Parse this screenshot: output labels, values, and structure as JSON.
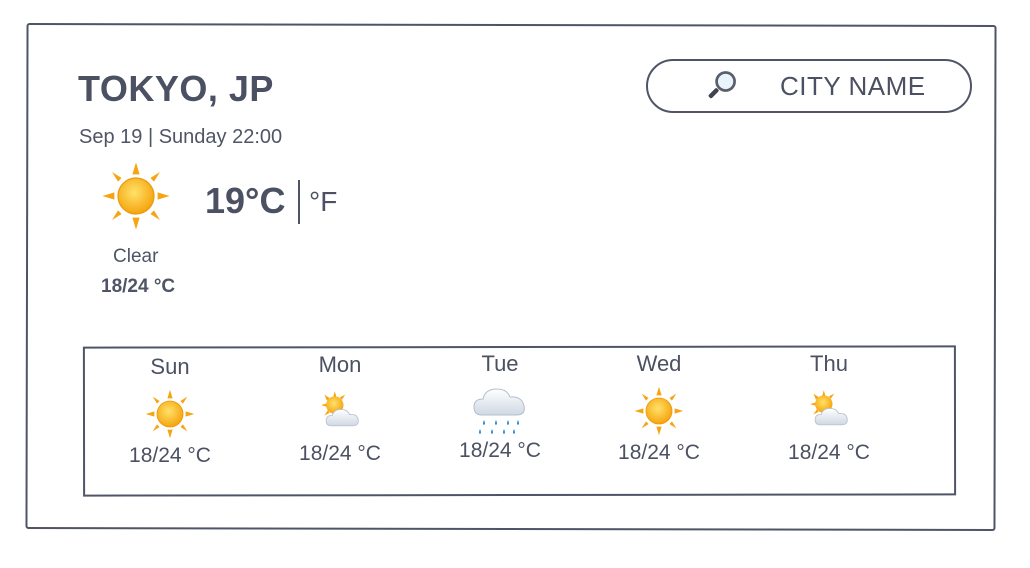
{
  "location": {
    "city": "TOKYO, JP",
    "datetime": "Sep 19 | Sunday 22:00"
  },
  "search": {
    "placeholder": "CITY NAME",
    "icon": "search-icon"
  },
  "current": {
    "icon": "sun-icon",
    "temperature": "19°C",
    "alt_unit": "°F",
    "condition": "Clear",
    "range": "18/24 °C"
  },
  "forecast": [
    {
      "day": "Sun",
      "icon": "sun-icon",
      "range": "18/24 °C"
    },
    {
      "day": "Mon",
      "icon": "sun-behind-cloud-icon",
      "range": "18/24 °C"
    },
    {
      "day": "Tue",
      "icon": "rain-cloud-icon",
      "range": "18/24 °C"
    },
    {
      "day": "Wed",
      "icon": "sun-icon",
      "range": "18/24 °C"
    },
    {
      "day": "Thu",
      "icon": "sun-behind-cloud-icon",
      "range": "18/24 °C"
    }
  ],
  "colors": {
    "text": "#4b5162",
    "sun": "#f7b51c",
    "cloud": "#e7ecf2",
    "rain": "#3a9ad9"
  }
}
